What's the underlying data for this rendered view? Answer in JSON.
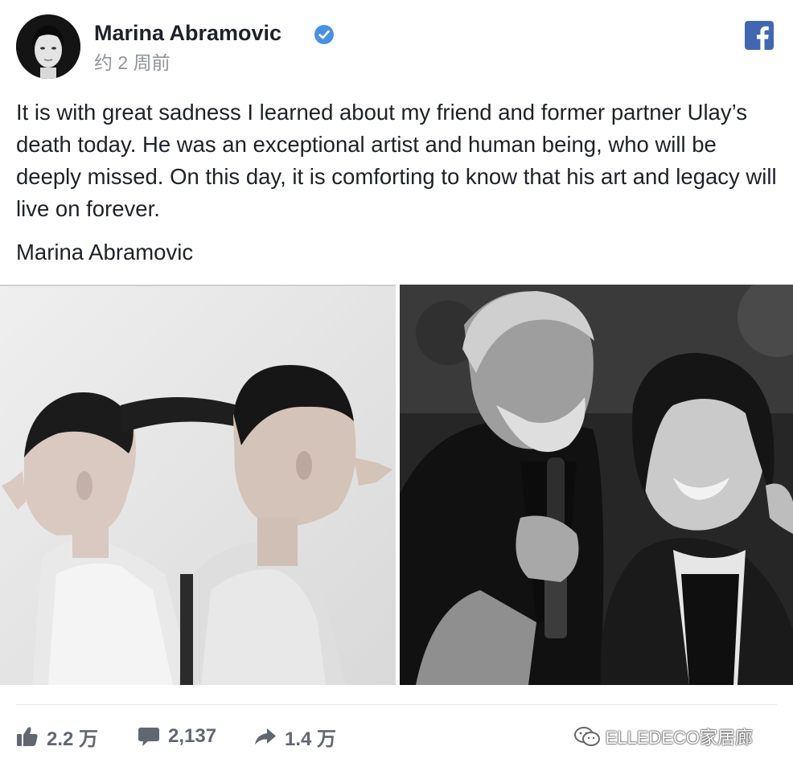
{
  "post": {
    "author": "Marina Abramovic",
    "verified": true,
    "timestamp": "约 2 周前",
    "text": "It is with great sadness I learned about my friend and former partner Ulay’s death today. He was an exceptional artist and human being, who will be deeply missed. On this day, it is comforting to know that his art and legacy will live on forever.",
    "attribution": "Marina Abramovic"
  },
  "stats": {
    "likes": "2.2 万",
    "comments": "2,137",
    "shares": "1.4 万"
  },
  "watermark": {
    "text": "ELLEDECO家居廊"
  },
  "colors": {
    "facebook_blue": "#4267b2",
    "verified_blue": "#4a90e2",
    "text_primary": "#1d2129",
    "text_secondary": "#90949c",
    "stat_gray": "#616770"
  },
  "icons": {
    "verified": "verified-badge-icon",
    "facebook": "facebook-logo-icon",
    "like": "thumbs-up-icon",
    "comment": "comment-bubble-icon",
    "share": "share-arrow-icon",
    "wechat": "wechat-icon"
  }
}
